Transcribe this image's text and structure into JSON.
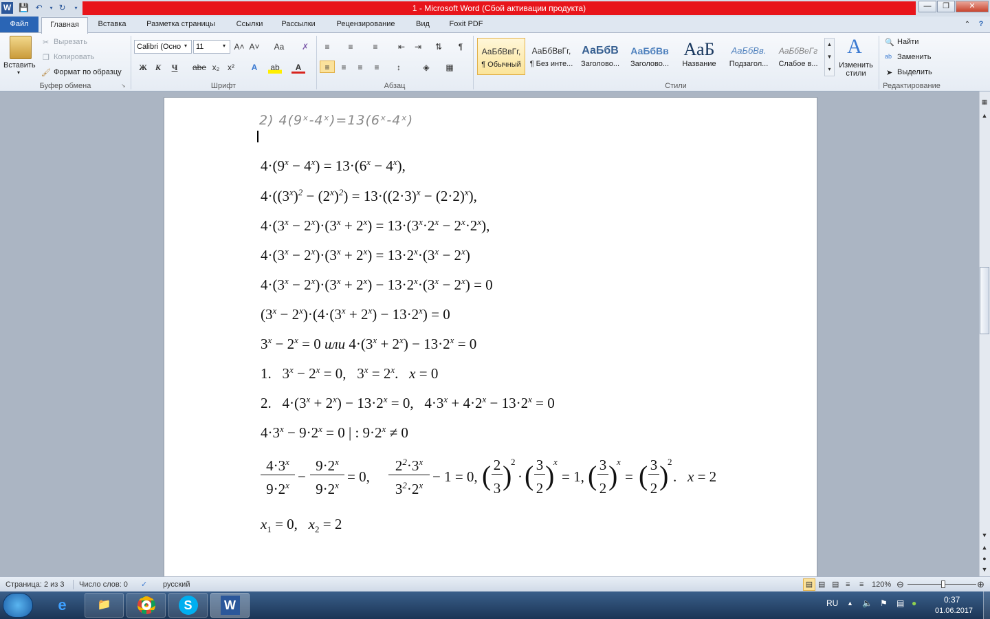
{
  "title": "1  -  Microsoft Word (Сбой активации продукта)",
  "qat_icons": [
    "word-logo-icon",
    "save-icon",
    "undo-icon",
    "redo-icon",
    "customize-icon"
  ],
  "tabs": {
    "file": "Файл",
    "home": "Главная",
    "insert": "Вставка",
    "layout": "Разметка страницы",
    "refs": "Ссылки",
    "mailings": "Рассылки",
    "review": "Рецензирование",
    "view": "Вид",
    "foxit": "Foxit PDF"
  },
  "clipboard": {
    "paste": "Вставить",
    "cut": "Вырезать",
    "copy": "Копировать",
    "format_painter": "Формат по образцу",
    "label": "Буфер обмена"
  },
  "font": {
    "name": "Calibri (Осно",
    "size": "11",
    "label": "Шрифт",
    "bold": "Ж",
    "italic": "К",
    "underline": "Ч",
    "strike": "abe",
    "subscript": "x₂",
    "superscript": "x²",
    "grow": "A˄",
    "shrink": "A˅",
    "case": "Aa"
  },
  "paragraph": {
    "label": "Абзац"
  },
  "styles": {
    "label": "Стили",
    "items": [
      {
        "sample": "АаБбВвГг,",
        "name": "¶ Обычный"
      },
      {
        "sample": "АаБбВвГг,",
        "name": "¶ Без инте..."
      },
      {
        "sample": "АаБбВ",
        "name": "Заголово..."
      },
      {
        "sample": "АаБбВв",
        "name": "Заголово..."
      },
      {
        "sample": "АаБ",
        "name": "Название"
      },
      {
        "sample": "АаБбВв.",
        "name": "Подзагол..."
      },
      {
        "sample": "АаБбВеГг",
        "name": "Слабое в..."
      }
    ],
    "change": "Изменить стили"
  },
  "editing": {
    "find": "Найти",
    "replace": "Заменить",
    "select": "Выделить",
    "label": "Редактирование"
  },
  "doc": {
    "handwritten": "2) 4(9ˣ-4ˣ)=13(6ˣ-4ˣ)"
  },
  "status": {
    "page": "Страница: 2 из 3",
    "words": "Число слов: 0",
    "lang": "русский",
    "zoom": "120%"
  },
  "taskbar": {
    "lang": "RU",
    "time": "0:37",
    "date": "01.06.2017"
  },
  "colors": {
    "title_red": "#e8151b",
    "file_tab": "#2a65b5",
    "taskbar": "#1b3556"
  }
}
